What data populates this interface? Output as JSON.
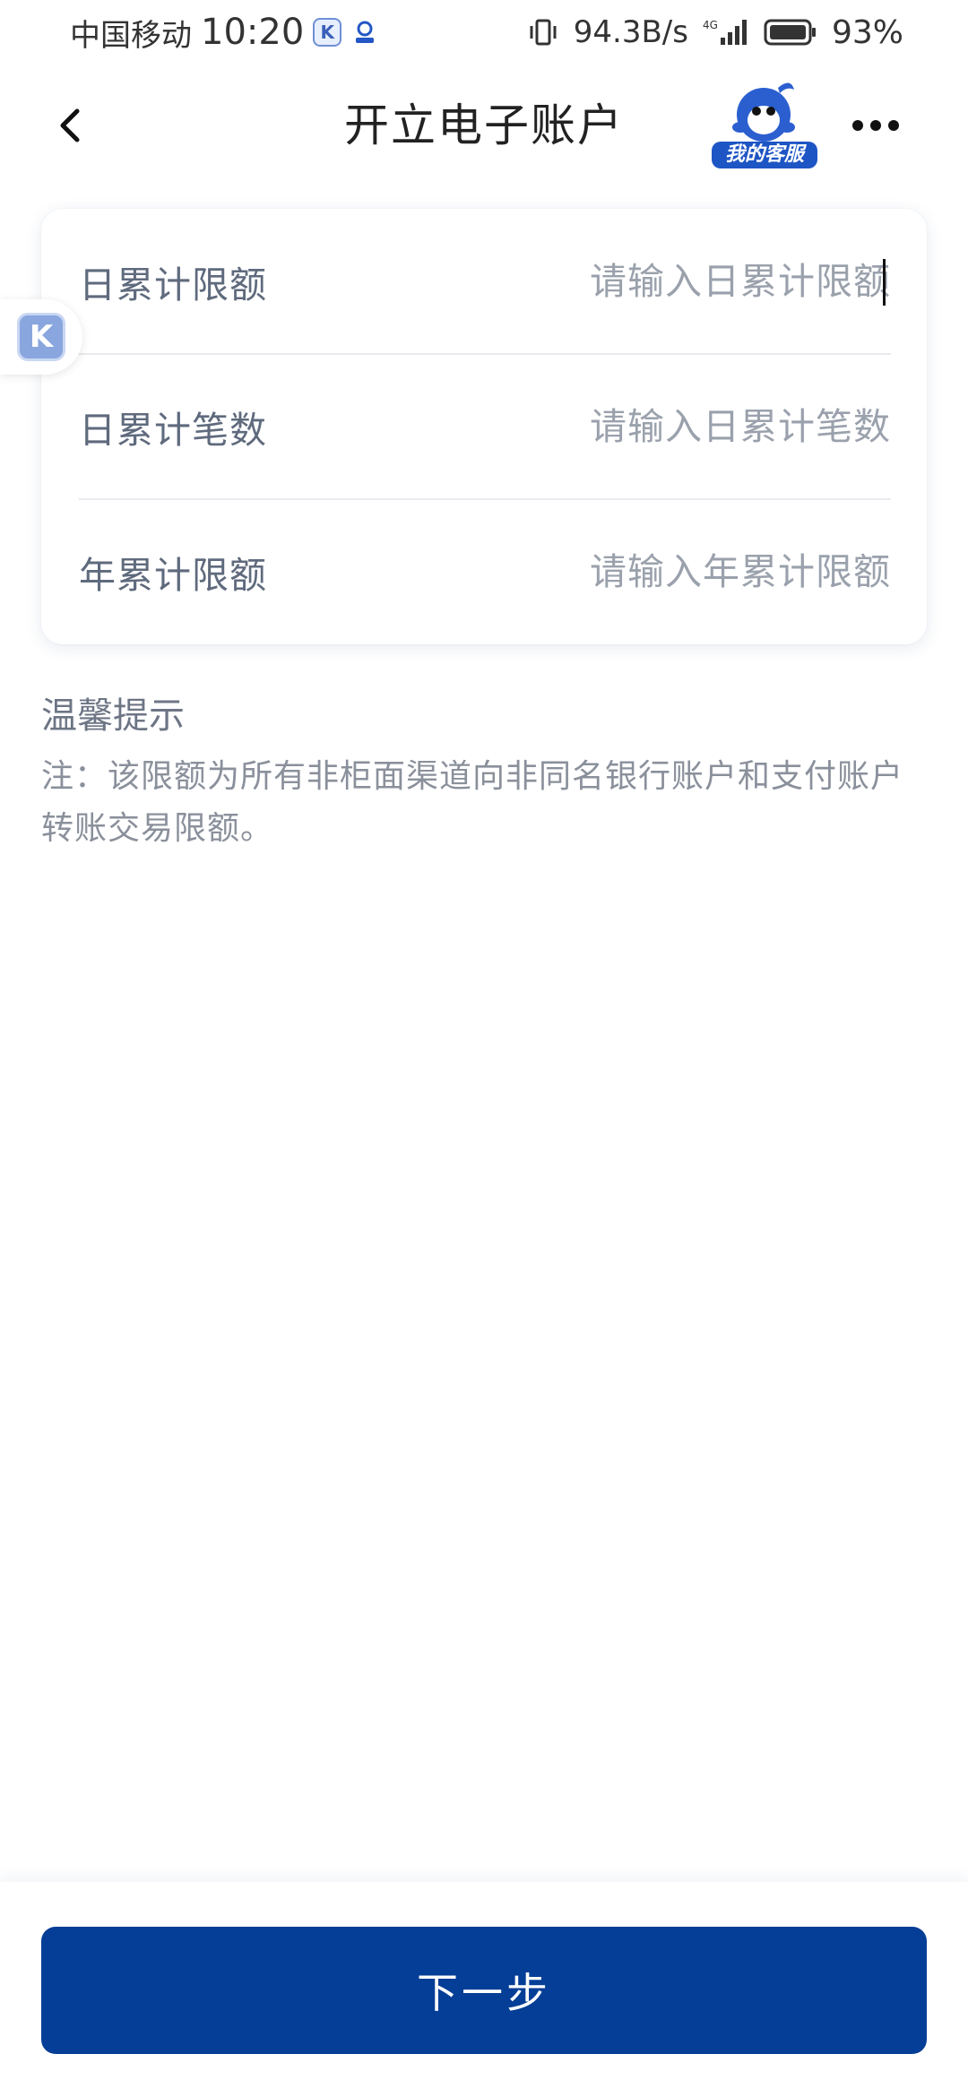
{
  "status_bar": {
    "carrier": "中国移动",
    "time": "10:20",
    "net_speed": "94.3B/s",
    "network": "4G",
    "battery": "93%"
  },
  "nav": {
    "title": "开立电子账户",
    "customer_service_label": "我的客服"
  },
  "form": {
    "rows": [
      {
        "label": "日累计限额",
        "placeholder": "请输入日累计限额",
        "value": ""
      },
      {
        "label": "日累计笔数",
        "placeholder": "请输入日累计笔数",
        "value": ""
      },
      {
        "label": "年累计限额",
        "placeholder": "请输入年累计限额",
        "value": ""
      }
    ]
  },
  "tips": {
    "title": "温馨提示",
    "text": "注：该限额为所有非柜面渠道向非同名银行账户和支付账户转账交易限额。"
  },
  "footer": {
    "next_label": "下一步"
  },
  "colors": {
    "primary": "#043e96",
    "label": "#5f6a7d",
    "placeholder": "#9aa1ac"
  },
  "icons": {
    "back": "chevron-left-icon",
    "more": "more-dots-icon",
    "float": "k-app-icon"
  }
}
